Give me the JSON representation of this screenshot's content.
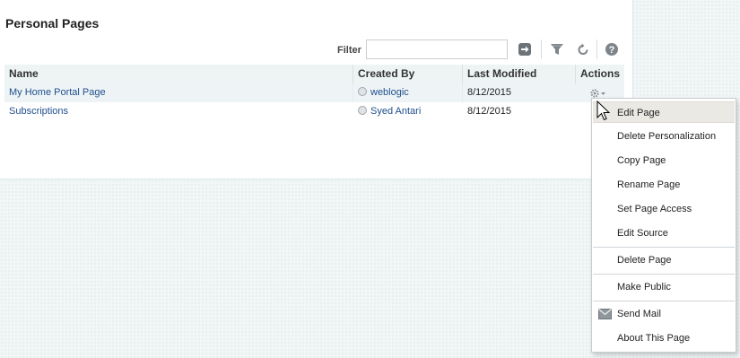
{
  "panel": {
    "title": "Personal Pages"
  },
  "toolbar": {
    "filter_label": "Filter",
    "filter_value": "",
    "icons": [
      "go-arrow-icon",
      "filter-funnel-icon",
      "refresh-icon",
      "help-icon"
    ]
  },
  "table": {
    "columns": [
      "Name",
      "Created By",
      "Last Modified",
      "Actions"
    ],
    "rows": [
      {
        "name": "My Home Portal Page",
        "created_by": "weblogic",
        "last_modified": "8/12/2015"
      },
      {
        "name": "Subscriptions",
        "created_by": "Syed Antari",
        "last_modified": "8/12/2015"
      }
    ]
  },
  "menu": {
    "items": [
      "Edit Page",
      "Delete Personalization",
      "Copy Page",
      "Rename Page",
      "Set Page Access",
      "Edit Source",
      "Delete Page",
      "Make Public",
      "Send Mail",
      "About This Page"
    ]
  },
  "colors": {
    "link": "#1f4e8c",
    "header_bg": "#eef4f4",
    "menu_hover": "#ebe9e4",
    "background": "#f1f6f6"
  }
}
